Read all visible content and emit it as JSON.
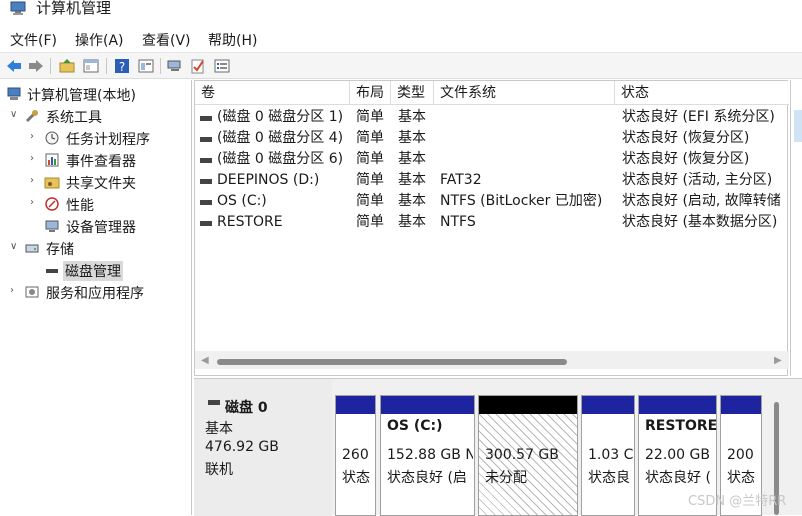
{
  "window": {
    "title": "计算机管理"
  },
  "menu": [
    "文件(F)",
    "操作(A)",
    "查看(V)",
    "帮助(H)"
  ],
  "toolbar": [
    "back-icon",
    "forward-icon",
    "up-folder-icon",
    "show-hide-tree-icon",
    "help-icon",
    "properties-icon",
    "connect-icon",
    "checklist-icon",
    "list-icon"
  ],
  "tree": {
    "root": "计算机管理(本地)",
    "system_tools": "系统工具",
    "task_scheduler": "任务计划程序",
    "event_viewer": "事件查看器",
    "shared_folders": "共享文件夹",
    "performance": "性能",
    "device_manager": "设备管理器",
    "storage": "存储",
    "disk_management": "磁盘管理",
    "services": "服务和应用程序"
  },
  "columns": {
    "volume": "卷",
    "layout": "布局",
    "type": "类型",
    "fs": "文件系统",
    "status": "状态"
  },
  "volumes": [
    {
      "name": "(磁盘 0 磁盘分区 1)",
      "layout": "简单",
      "type": "基本",
      "fs": "",
      "status": "状态良好 (EFI 系统分区)"
    },
    {
      "name": "(磁盘 0 磁盘分区 4)",
      "layout": "简单",
      "type": "基本",
      "fs": "",
      "status": "状态良好 (恢复分区)"
    },
    {
      "name": "(磁盘 0 磁盘分区 6)",
      "layout": "简单",
      "type": "基本",
      "fs": "",
      "status": "状态良好 (恢复分区)"
    },
    {
      "name": "DEEPINOS (D:)",
      "layout": "简单",
      "type": "基本",
      "fs": "FAT32",
      "status": "状态良好 (活动, 主分区)"
    },
    {
      "name": "OS (C:)",
      "layout": "简单",
      "type": "基本",
      "fs": "NTFS (BitLocker 已加密)",
      "status": "状态良好 (启动, 故障转储"
    },
    {
      "name": "RESTORE",
      "layout": "简单",
      "type": "基本",
      "fs": "NTFS",
      "status": "状态良好 (基本数据分区)"
    }
  ],
  "disk": {
    "name": "磁盘 0",
    "kind": "基本",
    "size": "476.92 GB",
    "state": "联机",
    "partitions": [
      {
        "title": "",
        "size": "260",
        "status": "状态"
      },
      {
        "title": "OS  (C:)",
        "size": "152.88 GB N",
        "status": "状态良好 (启"
      },
      {
        "title": "",
        "size": "300.57 GB",
        "status": "未分配"
      },
      {
        "title": "",
        "size": "1.03 C",
        "status": "状态良"
      },
      {
        "title": "RESTORE",
        "size": "22.00 GB",
        "status": "状态良好 ("
      },
      {
        "title": "",
        "size": "200",
        "status": "状态"
      }
    ]
  },
  "watermark": "CSDN @兰特RR",
  "colors": {
    "partition_band": "#1e23a0",
    "unallocated_band": "#000000"
  }
}
